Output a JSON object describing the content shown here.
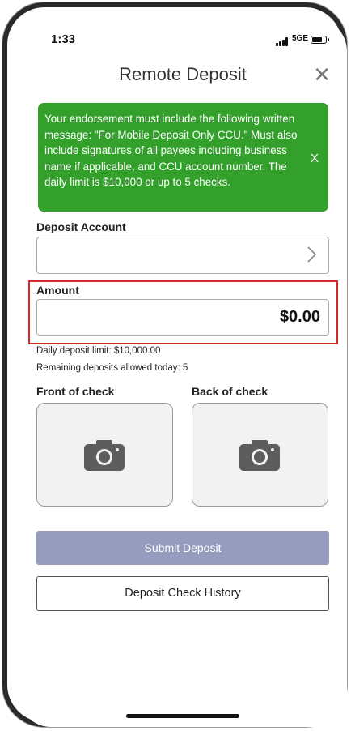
{
  "status_bar": {
    "time": "1:33",
    "network": "5GE"
  },
  "header": {
    "title": "Remote Deposit",
    "close_icon": "close-icon"
  },
  "banner": {
    "message": "Your endorsement must include the following written message: \"For Mobile Deposit Only CCU.\" Must also include signatures of all payees including business name if applicable, and CCU account number. The daily limit is $10,000 or up to 5 checks.",
    "dismiss": "X",
    "color": "#33a02c"
  },
  "deposit_account": {
    "label": "Deposit Account",
    "value": ""
  },
  "amount": {
    "label": "Amount",
    "value": "$0.00"
  },
  "limits": {
    "daily_limit": "Daily deposit limit: $10,000.00",
    "remaining": "Remaining deposits allowed today: 5"
  },
  "check_images": {
    "front_label": "Front of check",
    "back_label": "Back of check",
    "icon": "camera-icon"
  },
  "actions": {
    "submit_label": "Submit Deposit",
    "submit_color": "#959cbe",
    "history_label": "Deposit Check History"
  },
  "highlight_color": "#d42a2a"
}
